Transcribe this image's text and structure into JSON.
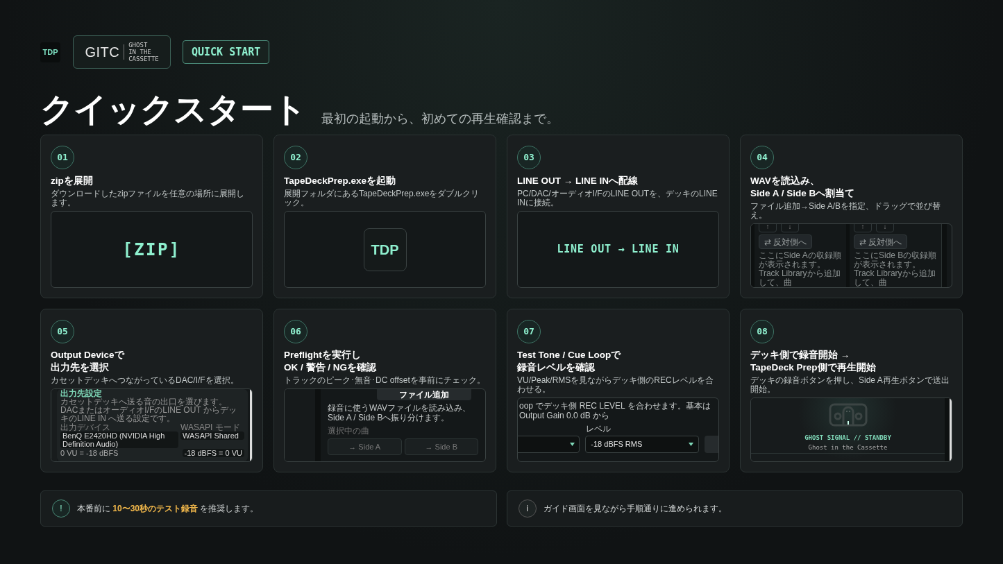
{
  "header": {
    "app_badge": "TDP",
    "logo": {
      "mark": "GITC",
      "tagline": [
        "GHOST",
        "IN THE",
        "CASSETTE"
      ]
    },
    "button": "QUICK START"
  },
  "title": "クイックスタート",
  "subtitle": "最初の起動から、初めての再生確認まで。",
  "steps": [
    {
      "number": "01",
      "title": [
        "zipを展開"
      ],
      "description": "ダウンロードしたzipファイルを任意の場所に展開します。",
      "preview": {
        "kind": "label",
        "text": "[ZIP]"
      }
    },
    {
      "number": "02",
      "title": [
        "TapeDeckPrep.exeを起動"
      ],
      "description": "展開フォルダにあるTapeDeckPrep.exeをダブルクリック。",
      "preview": {
        "kind": "app_icon",
        "text": "TDP"
      }
    },
    {
      "number": "03",
      "title": [
        "LINE OUT → LINE INへ配線"
      ],
      "description": "PC/DAC/オーディオI/FのLINE OUTを、デッキのLINE INに接続。",
      "preview": {
        "kind": "label",
        "text": "LINE OUT → LINE IN"
      }
    },
    {
      "number": "04",
      "title": [
        "WAVを読込み、",
        "Side A / Side Bへ割当て"
      ],
      "description": "ファイル追加→Side A/Bを指定、ドラッグで並び替え。",
      "preview": {
        "kind": "side_lists",
        "columns": [
          {
            "arrows": [
              "↑",
              "↓"
            ],
            "button": "⇄ 反対側へ",
            "text": "ここにSide Aの収録順が表示されます。Track Libraryから追加して、曲"
          },
          {
            "arrows": [
              "↑",
              "↓"
            ],
            "button": "⇄ 反対側へ",
            "text": "ここにSide Bの収録順が表示されます。Track Libraryから追加して、曲"
          }
        ]
      }
    },
    {
      "number": "05",
      "title": [
        "Output Deviceで",
        "出力先を選択"
      ],
      "description": "カセットデッキへつながっているDAC/I/Fを選択。",
      "preview": {
        "kind": "output_settings",
        "heading": "出力先設定",
        "note": "カセットデッキへ送る音の出口を選びます。DACまたはオーディオI/FのLINE OUT からデッキのLINE IN へ送る設定です。",
        "device_label": "出力デバイス",
        "device": "BenQ E2420HD (NVIDIA High Definition Audio)",
        "mode_label": "WASAPI モード",
        "mode": "WASAPI Shared",
        "ref_text": "0 VU = -18 dBFS",
        "ref_select": "-18 dBFS = 0 VU"
      }
    },
    {
      "number": "06",
      "title": [
        "Preflightを実行し",
        "OK / 警告 / NGを確認"
      ],
      "description": "トラックのピーク･無音･DC offsetを事前にチェック。",
      "preview": {
        "kind": "file_panel",
        "button": "ファイル追加",
        "text": "録音に使うWAVファイルを読み込み、Side A / Side Bへ振り分けます。",
        "selection_label": "選択中の曲",
        "actions": [
          "→ Side A",
          "→ Side B"
        ]
      }
    },
    {
      "number": "07",
      "title": [
        "Test Tone / Cue Loopで",
        "録音レベルを確認"
      ],
      "description": "VU/Peak/RMSを見ながらデッキ側のRECレベルを合わせる。",
      "preview": {
        "kind": "level_controls",
        "text": "oop でデッキ側 REC LEVEL を合わせます。基本は Output Gain 0.0 dB から",
        "label": "レベル",
        "select": "-18 dBFS RMS"
      }
    },
    {
      "number": "08",
      "title": [
        "デッキ側で録音開始 →",
        "TapeDeck Prep側で再生開始"
      ],
      "description": "デッキの録音ボタンを押し、Side A再生ボタンで送出開始。",
      "preview": {
        "kind": "standby",
        "status": "GHOST SIGNAL // STANDBY",
        "caption": "Ghost in the Cassette"
      }
    }
  ],
  "notes": [
    {
      "kind": "warning",
      "icon": "!",
      "parts": [
        {
          "text": "本番前に ",
          "highlight": false
        },
        {
          "text": "10〜30秒のテスト録音",
          "highlight": true
        },
        {
          "text": " を推奨します。",
          "highlight": false
        }
      ]
    },
    {
      "kind": "info",
      "icon": "i",
      "parts": [
        {
          "text": "ガイド画面を見ながら手順通りに進められます。",
          "highlight": false
        }
      ]
    }
  ]
}
